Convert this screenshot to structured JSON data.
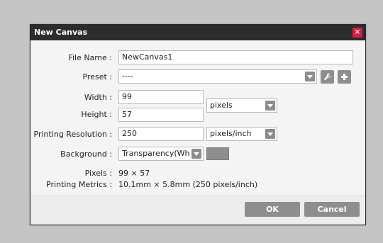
{
  "dialog": {
    "title": "New Canvas",
    "close_glyph": "×"
  },
  "labels": {
    "file_name": "File Name :",
    "preset": "Preset :",
    "width": "Width :",
    "height": "Height :",
    "printing_resolution": "Printing Resolution :",
    "background": "Background :",
    "pixels": "Pixels :",
    "printing_metrics": "Printing Metrics :"
  },
  "fields": {
    "file_name": "NewCanvas1",
    "preset": "----",
    "width": "99",
    "height": "57",
    "size_unit": "pixels",
    "resolution": "250",
    "resolution_unit": "pixels/inch",
    "background": "Transparency(White)"
  },
  "info": {
    "pixels": "99 × 57",
    "printing_metrics": "10.1mm × 5.8mm (250 pixels/inch)"
  },
  "buttons": {
    "ok": "OK",
    "cancel": "Cancel"
  },
  "icons": {
    "preset_settings": "wrench-icon",
    "preset_add": "plus-icon",
    "dropdown": "chevron-down-icon"
  },
  "colors": {
    "title_bar": "#2c2c2c",
    "close_button": "#d81e45",
    "button_bg": "#8e8e8e",
    "background_swatch": "#8e8e8e",
    "page_bg": "#c5c5c5"
  }
}
